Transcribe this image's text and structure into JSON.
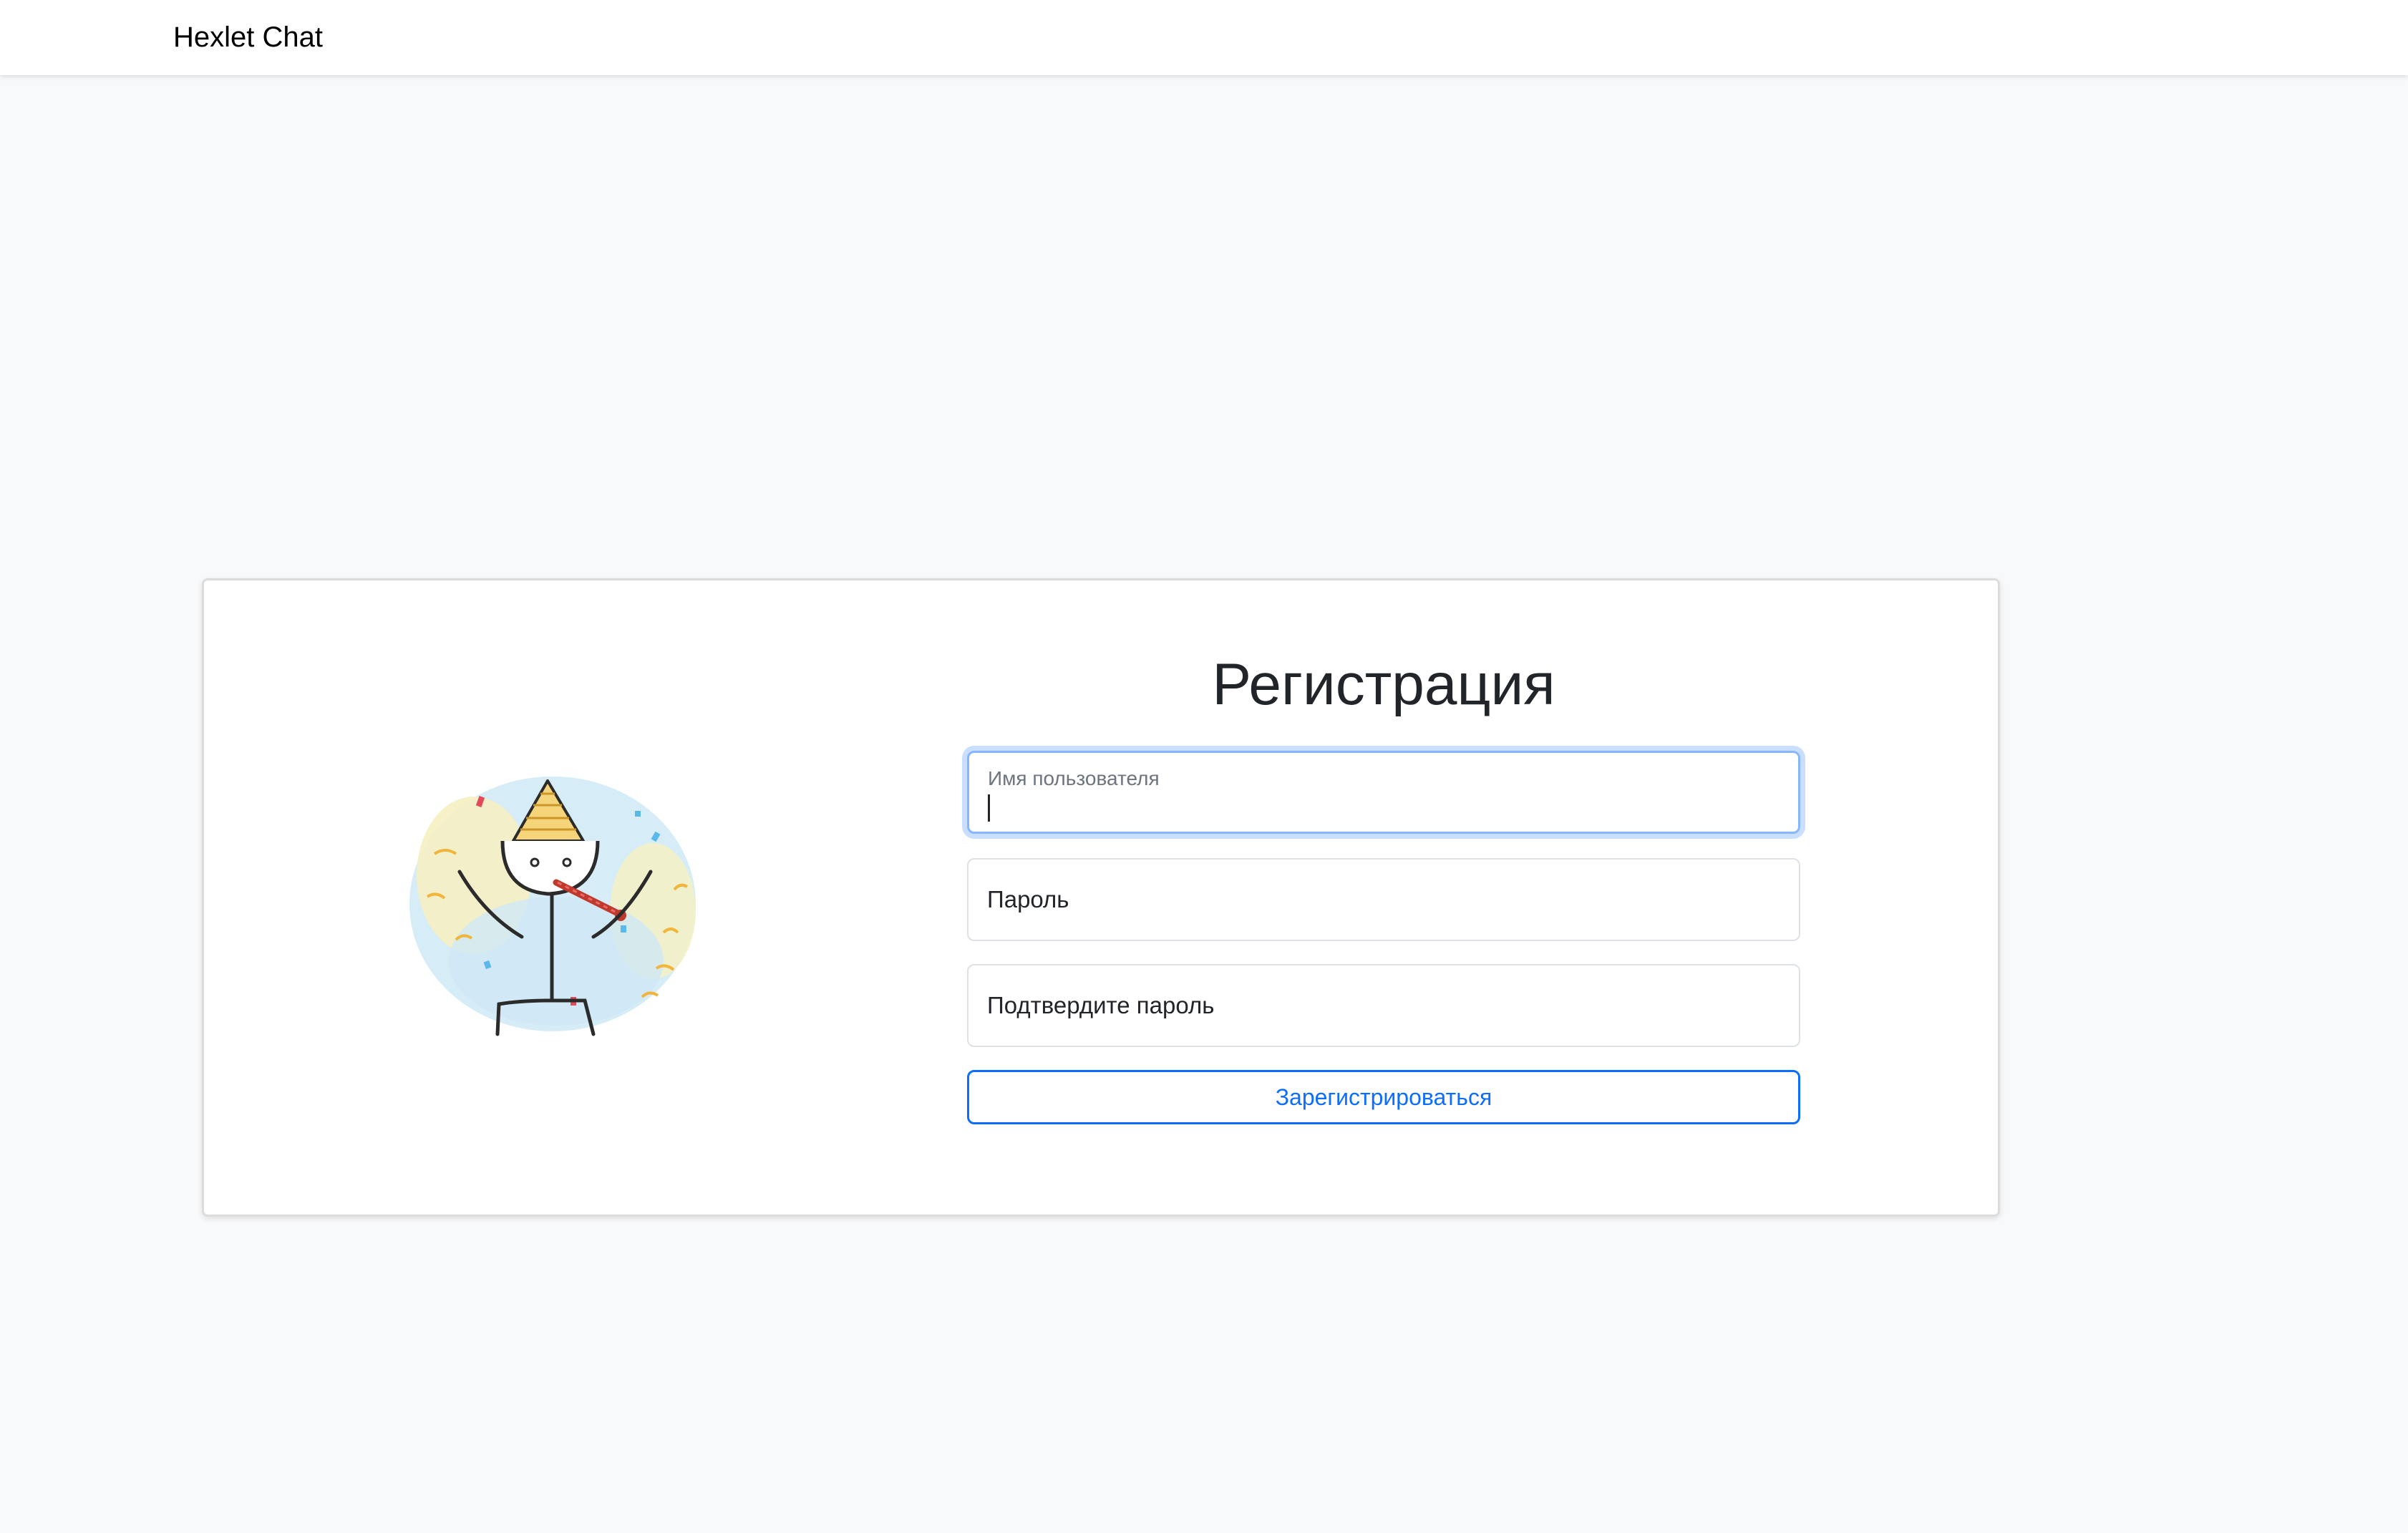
{
  "navbar": {
    "brand": "Hexlet Chat"
  },
  "signup": {
    "title": "Регистрация",
    "username": {
      "label": "Имя пользователя",
      "value": "",
      "focused": true
    },
    "password": {
      "label": "Пароль",
      "value": ""
    },
    "confirm_password": {
      "label": "Подтвердите пароль",
      "value": ""
    },
    "submit_label": "Зарегистрироваться"
  },
  "illustration": {
    "icon": "party-stickman-icon"
  },
  "colors": {
    "background": "#f8f9fa",
    "card": "#ffffff",
    "primary": "#0d6efd",
    "focus_ring": "#86b7fe",
    "text": "#212529",
    "muted": "#6c757d"
  }
}
